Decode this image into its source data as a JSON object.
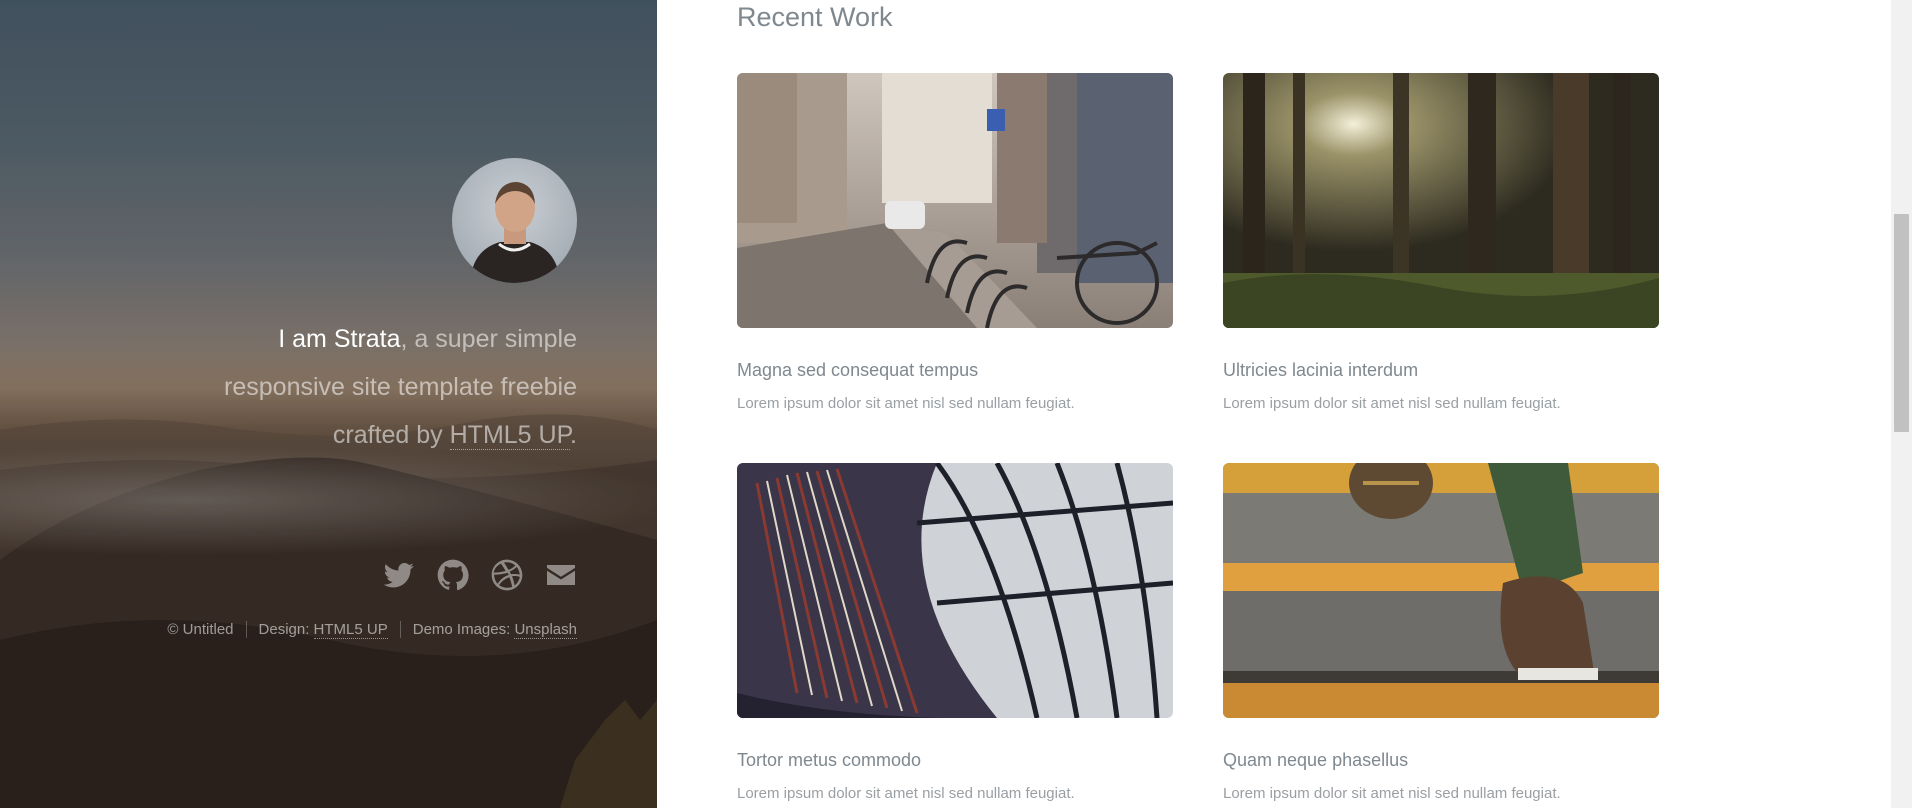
{
  "sidebar": {
    "intro": {
      "name": "I am Strata",
      "text1": ", a super simple",
      "text2": "responsive site template freebie",
      "text3": "crafted by ",
      "link": "HTML5 UP",
      "period": "."
    },
    "social_icons": [
      "twitter-icon",
      "github-icon",
      "dribbble-icon",
      "envelope-icon"
    ],
    "copyright": {
      "untitled": "© Untitled",
      "design_label": "Design: ",
      "design_link": "HTML5 UP",
      "images_label": "Demo Images: ",
      "images_link": "Unsplash"
    }
  },
  "main": {
    "section_title": "Recent Work",
    "works": [
      {
        "title": "Magna sed consequat tempus",
        "description": "Lorem ipsum dolor sit amet nisl sed nullam feugiat."
      },
      {
        "title": "Ultricies lacinia interdum",
        "description": "Lorem ipsum dolor sit amet nisl sed nullam feugiat."
      },
      {
        "title": "Tortor metus commodo",
        "description": "Lorem ipsum dolor sit amet nisl sed nullam feugiat."
      },
      {
        "title": "Quam neque phasellus",
        "description": "Lorem ipsum dolor sit amet nisl sed nullam feugiat."
      }
    ]
  },
  "colors": {
    "text_gray": "#7f888f",
    "desc_gray": "#9a9fa3",
    "accent_orange": "#e0a040"
  }
}
